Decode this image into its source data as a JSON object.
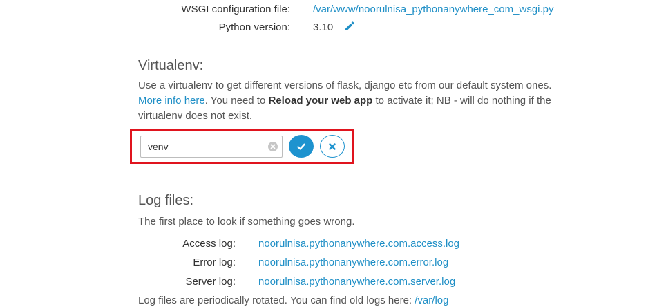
{
  "config": {
    "wsgi_label": "WSGI configuration file:",
    "wsgi_value": "/var/www/noorulnisa_pythonanywhere_com_wsgi.py",
    "python_label": "Python version:",
    "python_value": "3.10",
    "edit_icon": "pencil-icon"
  },
  "virtualenv": {
    "title": "Virtualenv:",
    "desc_part1": "Use a virtualenv to get different versions of flask, django etc from our default system ones.",
    "more_info_link": "More info here",
    "desc_part2": ". You need to",
    "reload_bold": "Reload your web app",
    "desc_part3": "to activate it; NB - will do nothing if the virtualenv does not exist.",
    "input_value": "venv",
    "clear_icon": "clear-circle-icon",
    "confirm_icon": "check-icon",
    "cancel_icon": "close-icon",
    "highlight_color": "#e0141e"
  },
  "logs": {
    "title": "Log files:",
    "intro": "The first place to look if something goes wrong.",
    "entries": [
      {
        "label": "Access log:",
        "value": "noorulnisa.pythonanywhere.com.access.log"
      },
      {
        "label": "Error log:",
        "value": "noorulnisa.pythonanywhere.com.error.log"
      },
      {
        "label": "Server log:",
        "value": "noorulnisa.pythonanywhere.com.server.log"
      }
    ],
    "rotation_note": "Log files are periodically rotated. You can find old logs here:",
    "old_logs_link": "/var/log"
  },
  "colors": {
    "link": "#1f8fc6",
    "accent": "#1e93cf"
  }
}
